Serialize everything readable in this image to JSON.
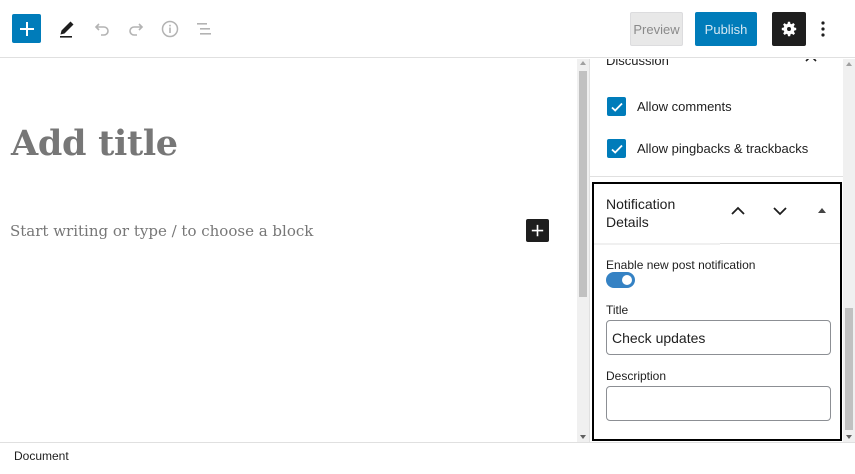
{
  "header": {
    "icons": {
      "inserter": "plus-icon",
      "tools": "pen-icon",
      "undo": "undo-icon",
      "redo": "redo-icon",
      "details": "info-icon",
      "outline": "list-view-icon",
      "settings": "gear-icon",
      "more": "more-vertical-icon"
    },
    "preview_label": "Preview",
    "publish_label": "Publish"
  },
  "editor": {
    "title_placeholder": "Add title",
    "block_placeholder": "Start writing or type / to choose a block",
    "block_inserter_icon": "plus-icon"
  },
  "sidebar": {
    "discussion": {
      "title": "Discussion",
      "toggle_icon": "chevron-up-icon",
      "options": [
        {
          "label": "Allow comments",
          "checked": true
        },
        {
          "label": "Allow pingbacks & trackbacks",
          "checked": true
        }
      ]
    },
    "notification": {
      "title": "Notification Details",
      "move_up_icon": "chevron-up-icon",
      "move_down_icon": "chevron-down-icon",
      "collapse_icon": "triangle-up-icon",
      "enable_label": "Enable new post notification",
      "enable_on": true,
      "title_label": "Title",
      "title_value": "Check updates",
      "description_label": "Description",
      "description_value": ""
    }
  },
  "footer": {
    "breadcrumb": "Document"
  },
  "colors": {
    "accent": "#007cba",
    "toggle_on": "#3582c4",
    "dark": "#1e1e1e"
  }
}
